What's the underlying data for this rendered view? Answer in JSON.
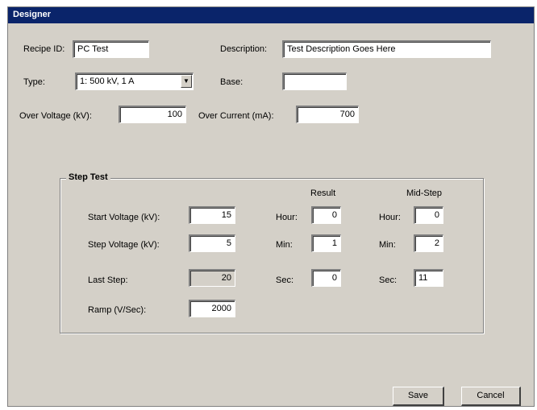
{
  "window": {
    "title": "Designer"
  },
  "form": {
    "recipe_id_label": "Recipe ID:",
    "recipe_id_value": "PC Test",
    "description_label": "Description:",
    "description_value": "Test Description Goes Here",
    "type_label": "Type:",
    "type_value": "1: 500 kV, 1 A",
    "base_label": "Base:",
    "base_value": "",
    "over_voltage_label": "Over Voltage (kV):",
    "over_voltage_value": "100",
    "over_current_label": "Over Current (mA):",
    "over_current_value": "700"
  },
  "step_test": {
    "group_label": "Step Test",
    "result_header": "Result",
    "mid_header": "Mid-Step",
    "start_voltage_label": "Start Voltage (kV):",
    "start_voltage_value": "15",
    "step_voltage_label": "Step Voltage (kV):",
    "step_voltage_value": "5",
    "last_step_label": "Last Step:",
    "last_step_value": "20",
    "ramp_label": "Ramp (V/Sec):",
    "ramp_value": "2000",
    "result_hour_label": "Hour:",
    "result_hour_value": "0",
    "result_min_label": "Min:",
    "result_min_value": "1",
    "result_sec_label": "Sec:",
    "result_sec_value": "0",
    "mid_hour_label": "Hour:",
    "mid_hour_value": "0",
    "mid_min_label": "Min:",
    "mid_min_value": "2",
    "mid_sec_label": "Sec:",
    "mid_sec_value": "11"
  },
  "buttons": {
    "save_label": "Save",
    "cancel_label": "Cancel"
  }
}
